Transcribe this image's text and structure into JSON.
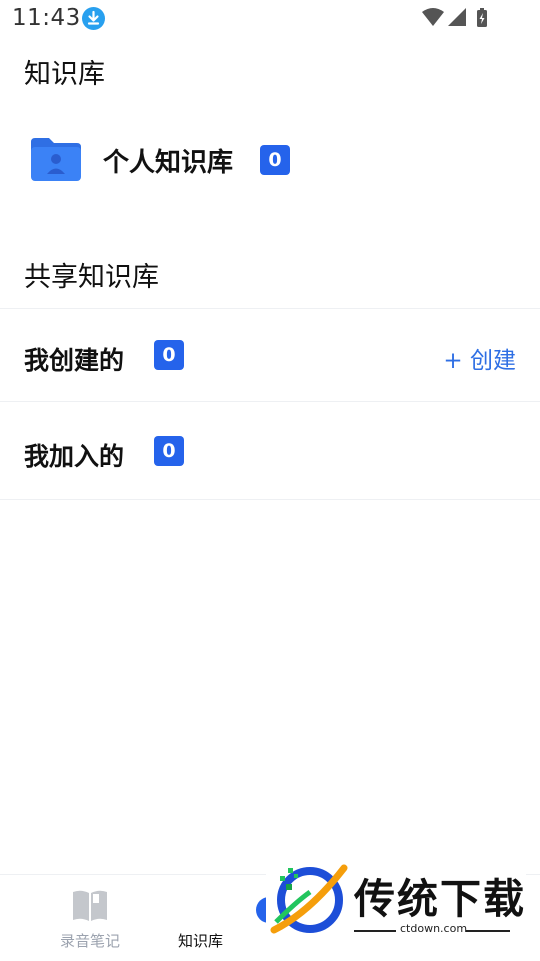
{
  "status_bar": {
    "time": "11:43",
    "icons": [
      "download-icon",
      "wifi-icon",
      "signal-icon",
      "battery-charging-icon"
    ]
  },
  "page": {
    "title": "知识库"
  },
  "personal": {
    "label": "个人知识库",
    "count": "0",
    "icon": "folder-person-icon"
  },
  "shared": {
    "section_title": "共享知识库",
    "created": {
      "label": "我创建的",
      "count": "0",
      "action_label": "+ 创建"
    },
    "joined": {
      "label": "我加入的",
      "count": "0"
    }
  },
  "bottom_nav": {
    "items": [
      {
        "label": "录音笔记",
        "icon": "book-icon",
        "active": false
      },
      {
        "label": "知识库",
        "icon": "knowledge-base-icon",
        "active": true
      }
    ]
  },
  "watermark": {
    "text": "传统下载",
    "url": "ctdown.com"
  },
  "colors": {
    "accent": "#2563eb",
    "link": "#2f6fe4",
    "status_download": "#28a0ef"
  }
}
